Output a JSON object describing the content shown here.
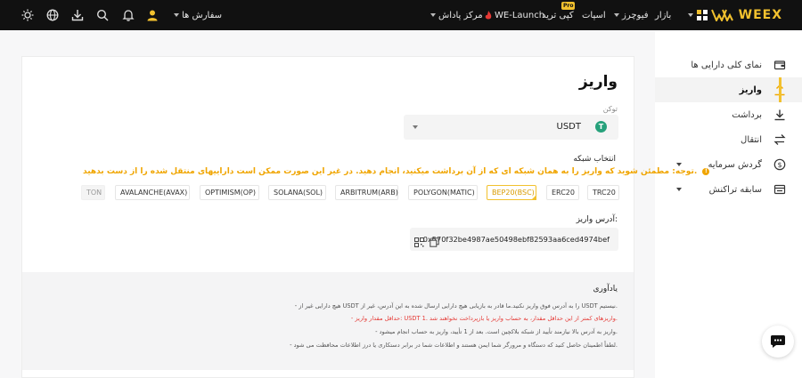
{
  "topbar": {
    "logo": "WEEX",
    "nav": {
      "market": "بازار",
      "futures": "فیوچرز",
      "spot": "اسپات",
      "copy_trade": "کپی ترید",
      "pro_badge": "Pro",
      "we_launch": "WE-Launch",
      "rewards": "مرکز پاداش",
      "orders": "سفارش ها"
    },
    "icons": [
      "grid-icon",
      "user-icon",
      "bell-icon",
      "search-icon",
      "download-icon",
      "globe-icon",
      "sun-icon"
    ]
  },
  "sidebar": {
    "items": [
      {
        "label": "نمای کلی دارایی ها",
        "icon": "wallet-icon"
      },
      {
        "label": "واریز",
        "icon": "deposit-icon",
        "active": true
      },
      {
        "label": "برداشت",
        "icon": "withdraw-icon"
      },
      {
        "label": "انتقال",
        "icon": "transfer-icon"
      },
      {
        "label": "گردش سرمایه",
        "icon": "dollar-circle-icon",
        "expandable": true
      },
      {
        "label": "سابقه تراکنش",
        "icon": "history-icon",
        "expandable": true
      }
    ]
  },
  "deposit": {
    "title": "واریز",
    "token_label": "توکن",
    "token_value": "USDT",
    "token_symbol": "T",
    "network_label": "انتخاب شبکه",
    "warning": "توجه: مطمئن شوید که واریز را به همان شبکه ای که از آن برداشت میکنید، انجام دهید. در غیر این صورت ممکن است داراییهای منتقل شده را از دست بدهید.",
    "networks": [
      "TRC20",
      "ERC20",
      "BEP20(BSC)",
      "POLYGON(MATIC)",
      "ARBITRUM(ARB)",
      "SOLANA(SOL)",
      "OPTIMISM(OP)",
      "AVALANCHE(AVAX)",
      "TON"
    ],
    "selected_network": "BEP20(BSC)",
    "disabled_network": "TON",
    "address_label": "آدرس واریز:",
    "address": "0x570f32be4987ae50498ebf82593aa6ced4974bef"
  },
  "reminder": {
    "title": "یادآوری",
    "lines": [
      "- هیچ دارایی غیر از USDT را به آدرس فوق واریز نکنید.ما قادر به بازیابی هیچ دارایی ارسال شده به این آدرس، غیر از USDT نیستیم.",
      "- حداقل مقدار واریز: USDT 1. واریزهای کمتر از این حداقل مقدار، به حساب واریز یا بازپرداخت نخواهند شد.",
      "- واریز به آدرس بالا نیازمند تأیید از شبکه بلاکچین است. بعد از 1 تأیید، واریز به حساب انجام میشود.",
      "- لطفاً اطمینان حاصل کنید که دستگاه و مرورگر شما ایمن هستند و اطلاعات شما در برابر دستکاری یا درز اطلاعات محافظت می شود."
    ]
  },
  "colors": {
    "accent": "#f2c12e",
    "warning": "#f0a500",
    "danger": "#e53935",
    "tether": "#26a17b"
  }
}
